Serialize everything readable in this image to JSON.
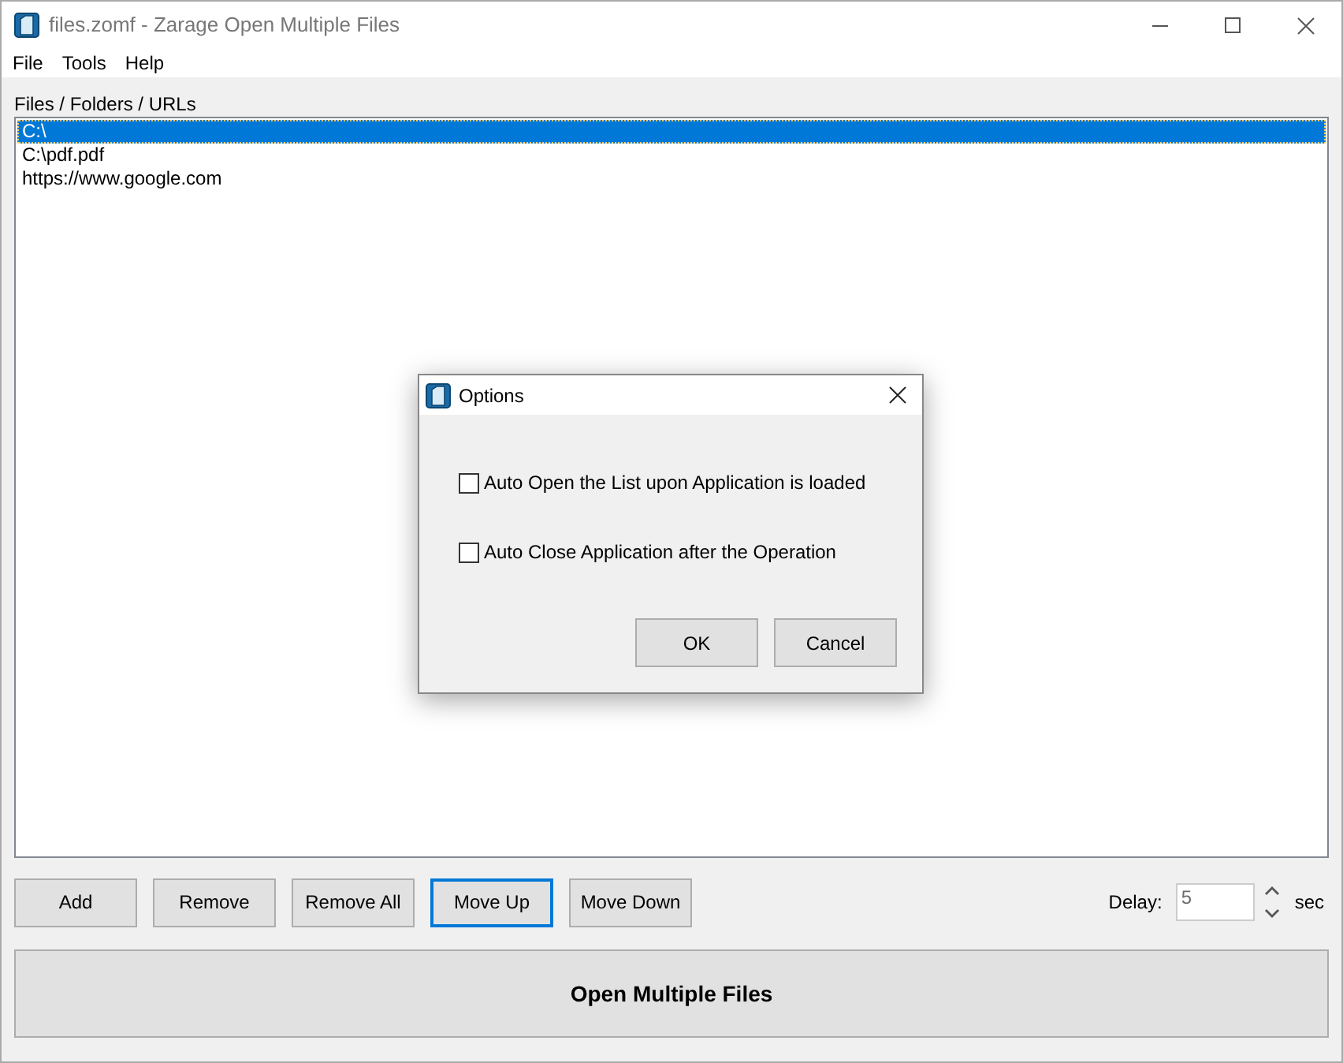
{
  "window": {
    "title": "files.zomf - Zarage Open Multiple Files"
  },
  "menu": [
    "File",
    "Tools",
    "Help"
  ],
  "list": {
    "label": "Files / Folders / URLs",
    "items": [
      {
        "text": "C:\\",
        "selected": true
      },
      {
        "text": "C:\\pdf.pdf",
        "selected": false
      },
      {
        "text": "https://www.google.com",
        "selected": false
      }
    ]
  },
  "buttons": [
    {
      "label": "Add",
      "focused": false
    },
    {
      "label": "Remove",
      "focused": false
    },
    {
      "label": "Remove All",
      "focused": false
    },
    {
      "label": "Move Up",
      "focused": true
    },
    {
      "label": "Move Down",
      "focused": false
    }
  ],
  "delay": {
    "label": "Delay:",
    "value": "5",
    "unit": "sec"
  },
  "main_button": "Open Multiple Files",
  "dialog": {
    "title": "Options",
    "options": [
      {
        "label": "Auto Open the List upon Application is loaded",
        "checked": false
      },
      {
        "label": "Auto Close Application after the Operation",
        "checked": false
      }
    ],
    "buttons": [
      "OK",
      "Cancel"
    ]
  }
}
